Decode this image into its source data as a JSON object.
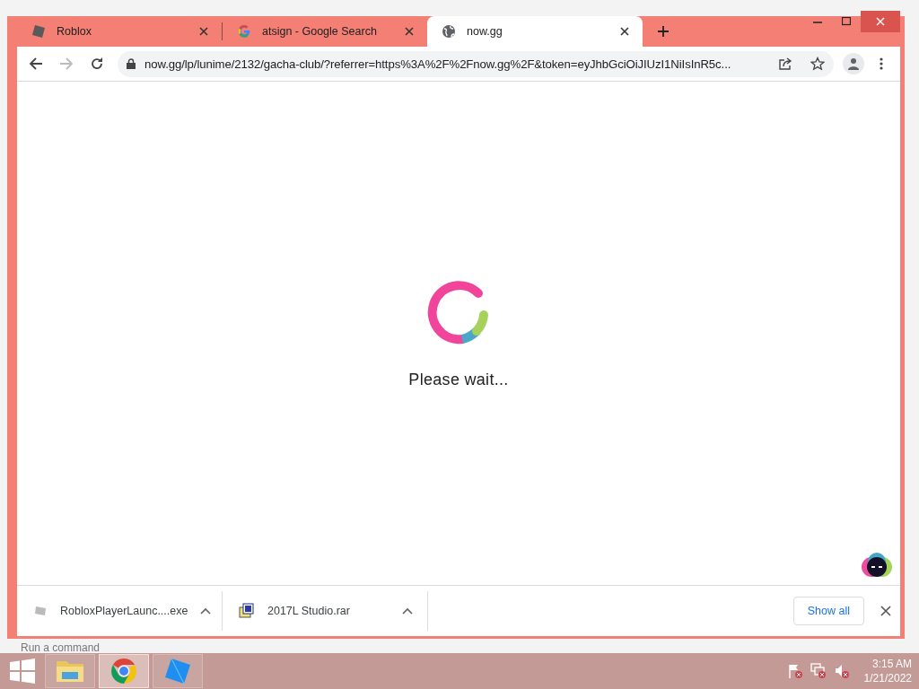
{
  "tabs": [
    {
      "title": "Roblox",
      "kind": "roblox",
      "selected": false
    },
    {
      "title": "atsign - Google Search",
      "kind": "google",
      "selected": false
    },
    {
      "title": "now.gg",
      "kind": "globe",
      "selected": true
    }
  ],
  "address_bar": {
    "url": "now.gg/lp/lunime/2132/gacha-club/?referrer=https%3A%2F%2Fnow.gg%2F&token=eyJhbGciOiJIUzI1NiIsInR5c..."
  },
  "page": {
    "message": "Please wait..."
  },
  "downloads": {
    "items": [
      {
        "name": "RobloxPlayerLaunc....exe",
        "kind": "roblox"
      },
      {
        "name": "2017L Studio.rar",
        "kind": "rar"
      }
    ],
    "show_all": "Show all"
  },
  "desktop": {
    "behind_text": "Run a command"
  },
  "taskbar": {
    "apps": [
      {
        "kind": "explorer",
        "selected": false
      },
      {
        "kind": "chrome",
        "selected": true
      },
      {
        "kind": "studio",
        "selected": false
      }
    ],
    "time": "3:15 AM",
    "date": "1/21/2022"
  }
}
